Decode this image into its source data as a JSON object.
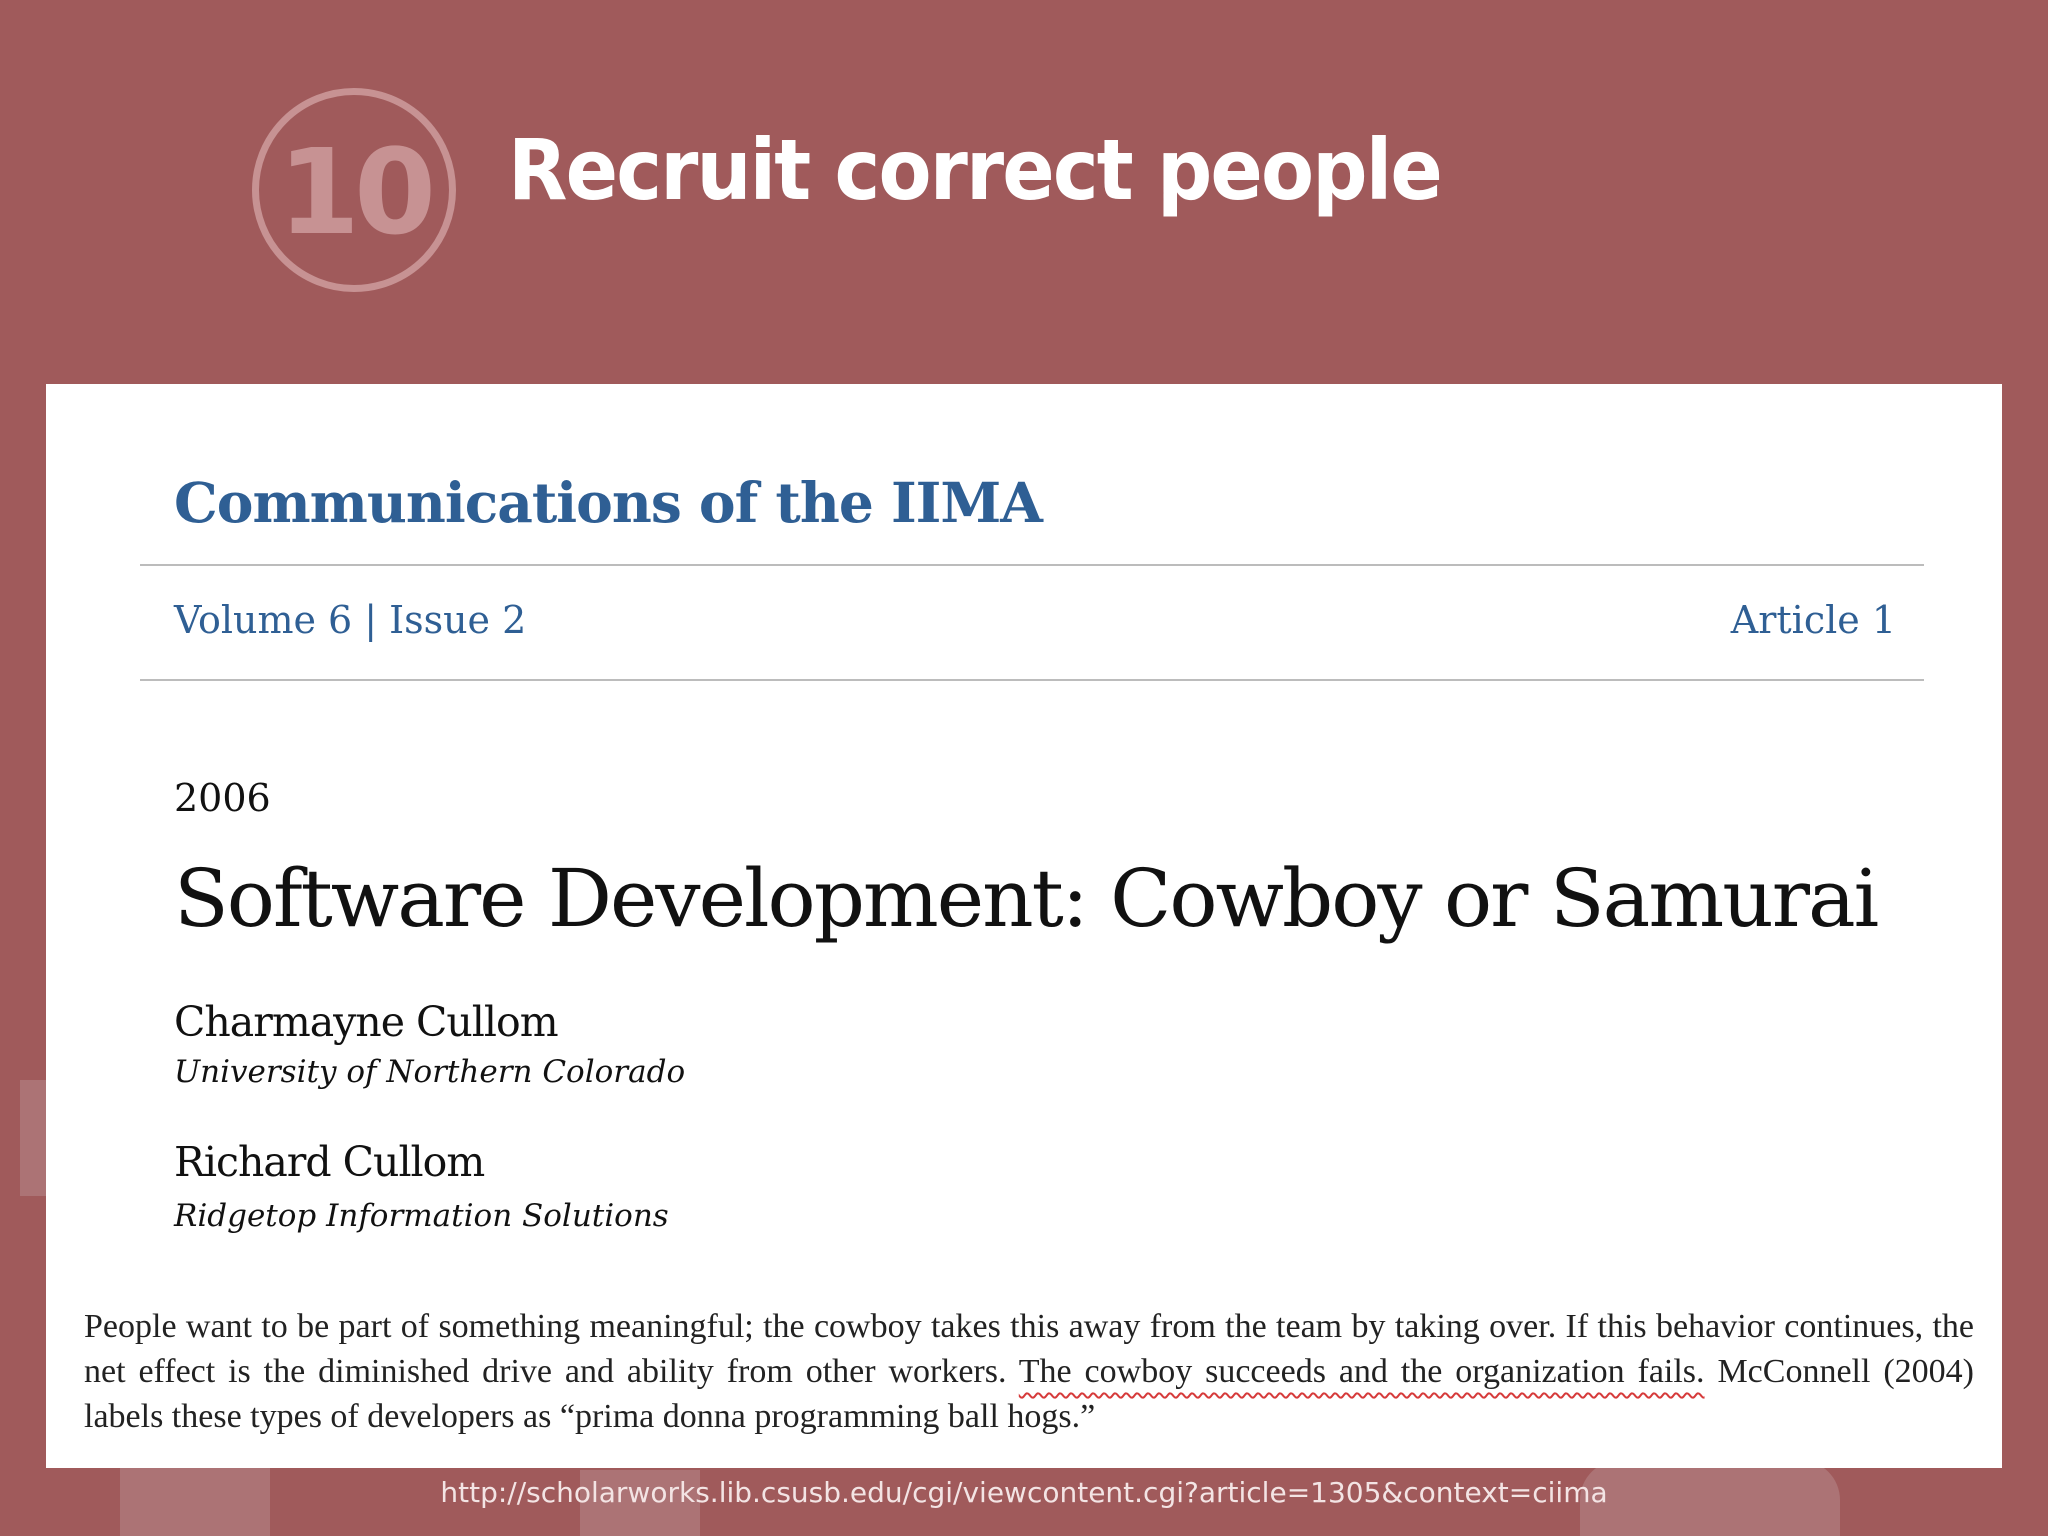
{
  "slide": {
    "number": "10",
    "title": "Recruit correct people",
    "source_url": "http://scholarworks.lib.csusb.edu/cgi/viewcontent.cgi?article=1305&context=ciima"
  },
  "paper": {
    "journal": "Communications of the IIMA",
    "volume": "Volume 6",
    "separator": "|",
    "issue": "Issue 2",
    "article": "Article 1",
    "year": "2006",
    "title": "Software Development: Cowboy or Samurai",
    "authors": [
      {
        "name": "Charmayne Cullom",
        "affiliation": "University of Northern Colorado"
      },
      {
        "name": "Richard Cullom",
        "affiliation": "Ridgetop Information Solutions"
      }
    ],
    "excerpt": {
      "before": "People want to be part of something meaningful; the cowboy takes this away from the team by taking over. If this behavior continues, the net effect is the diminished drive and ability from other workers. ",
      "highlight": "The cowboy succeeds and the organization fails.",
      "after": "  McConnell (2004) labels these types of developers as “prima donna programming ball hogs.”"
    }
  },
  "colors": {
    "background": "#a05a5b",
    "journal_blue": "#2f5f94",
    "highlight_underline": "#d63b3b"
  }
}
